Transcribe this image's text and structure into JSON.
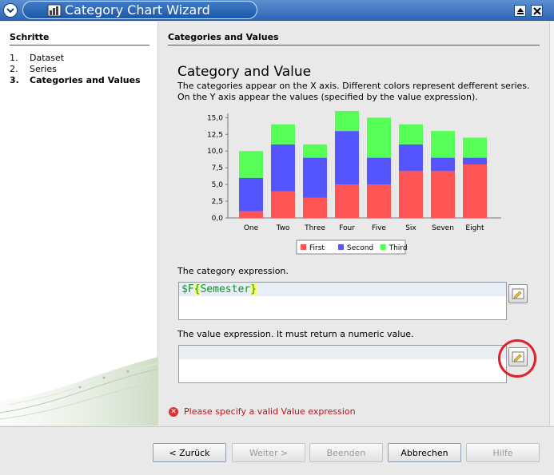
{
  "window": {
    "title": "Category Chart Wizard"
  },
  "steps": {
    "title": "Schritte",
    "items": [
      {
        "num": "1.",
        "label": "Dataset",
        "current": false
      },
      {
        "num": "2.",
        "label": "Series",
        "current": false
      },
      {
        "num": "3.",
        "label": "Categories and Values",
        "current": true
      }
    ]
  },
  "content": {
    "section_title": "Categories and Values",
    "heading": "Category and Value",
    "desc_line1": "The categories appear on the X axis. Different colors represent defferent series.",
    "desc_line2": "On the Y axis appear the values (specified by the value expression).",
    "category_label": "The category expression.",
    "category_expression_prefix": "$F",
    "category_expression_open": "{",
    "category_expression_field": "Semester",
    "category_expression_close": "}",
    "value_label": "The value expression. It must return a numeric value.",
    "value_expression": "",
    "error_message": "Please specify a valid Value expression"
  },
  "chart_data": {
    "type": "bar",
    "stacked": true,
    "categories": [
      "One",
      "Two",
      "Three",
      "Four",
      "Five",
      "Six",
      "Seven",
      "Eight"
    ],
    "series": [
      {
        "name": "First",
        "color": "#ff5555",
        "values": [
          1,
          4,
          3,
          5,
          5,
          7,
          7,
          8
        ]
      },
      {
        "name": "Second",
        "color": "#5555ff",
        "values": [
          5,
          7,
          6,
          8,
          4,
          4,
          2,
          1
        ]
      },
      {
        "name": "Third",
        "color": "#55ff55",
        "values": [
          4,
          3,
          2,
          3,
          6,
          3,
          4,
          3
        ]
      }
    ],
    "y_ticks": [
      "0,0",
      "2,5",
      "5,0",
      "7,5",
      "10,0",
      "12,5",
      "15,0"
    ],
    "ylim": [
      0,
      16
    ],
    "legend_position": "bottom",
    "grid": false
  },
  "buttons": {
    "back": "< Zurück",
    "next": "Weiter >",
    "finish": "Beenden",
    "cancel": "Abbrechen",
    "help": "Hilfe"
  }
}
